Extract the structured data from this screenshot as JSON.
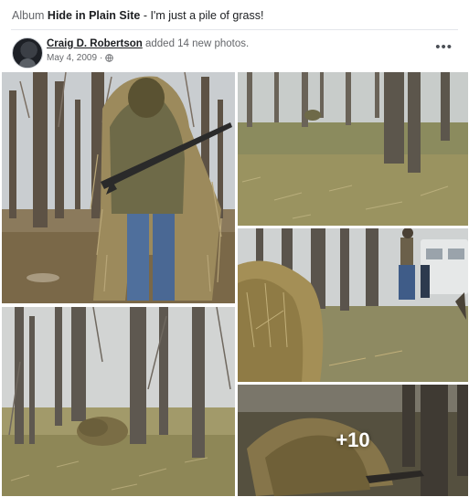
{
  "post": {
    "album_prefix": "Album",
    "album_name": "Hide in Plain Site",
    "album_sep": " - ",
    "album_caption": "I'm just a pile of grass!",
    "author": "Craig D. Robertson",
    "action": " added 14 new photos.",
    "date": "May 4, 2009",
    "date_sep": " · ",
    "privacy_icon": "globe-icon",
    "more_label": "•••"
  },
  "photos": [
    {
      "id": "photo-1",
      "scene": "ghillie-suit-man-with-rifle-in-woods"
    },
    {
      "id": "photo-2",
      "scene": "grassy-forest-clearing-with-hidden-figure"
    },
    {
      "id": "photo-3",
      "scene": "grass-pile-among-trees"
    },
    {
      "id": "photo-4",
      "scene": "grass-pile-foreground-people-and-rv"
    },
    {
      "id": "photo-5",
      "scene": "grass-pile-near-tree",
      "overlay": "+10"
    }
  ],
  "colors": {
    "text": "#1c1e21",
    "muted": "#65676b",
    "divider": "#e4e6eb"
  }
}
